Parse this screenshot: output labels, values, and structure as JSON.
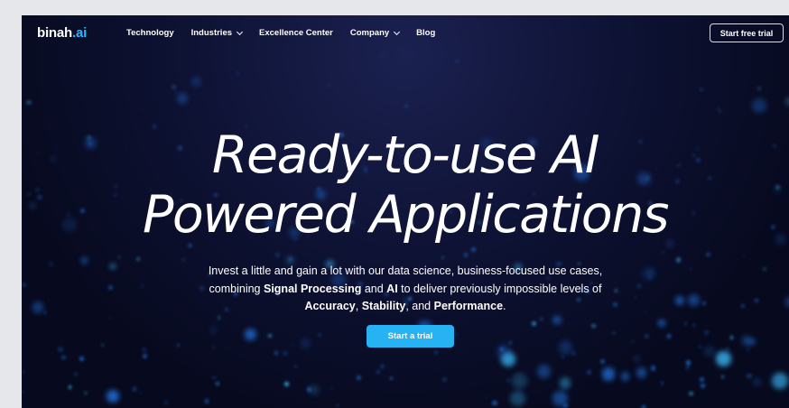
{
  "nav": {
    "logo_main": "binah",
    "logo_suffix": ".ai",
    "items": [
      {
        "label": "Technology"
      },
      {
        "label": "Industries"
      },
      {
        "label": "Excellence Center"
      },
      {
        "label": "Company"
      },
      {
        "label": "Blog"
      }
    ],
    "trial_button": "Start free trial"
  },
  "hero": {
    "headline_line1": "Ready-to-use AI",
    "headline_line2": "Powered Applications",
    "sub_line1": "Invest a little and gain a lot with our data science, business-focused use cases,",
    "sub_line2_a": "combining ",
    "sub_line2_b": "Signal Processing",
    "sub_line2_c": " and ",
    "sub_line2_d": "AI",
    "sub_line2_e": " to deliver previously impossible levels of",
    "sub_line3_a": "Accuracy",
    "sub_line3_b": ", ",
    "sub_line3_c": "Stability",
    "sub_line3_d": ", and ",
    "sub_line3_e": "Performance",
    "sub_line3_f": ".",
    "cta_label": "Start a trial"
  },
  "colors": {
    "background": "#070a1f",
    "accent": "#27b3f3",
    "logo_accent": "#2bb4ff"
  }
}
